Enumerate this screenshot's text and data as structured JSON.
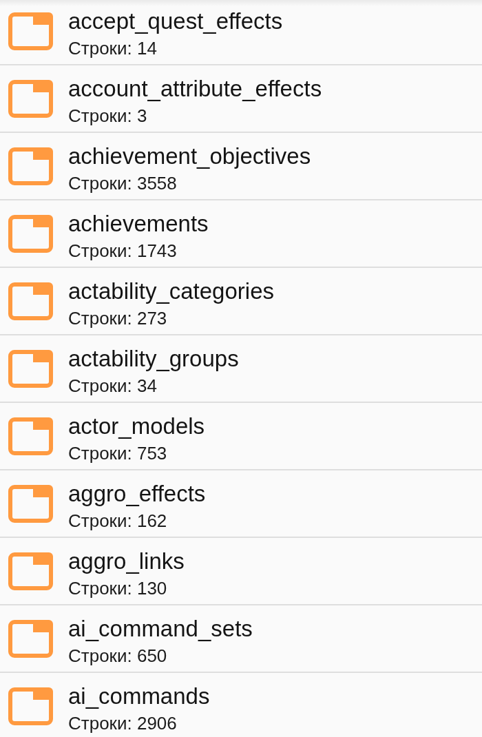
{
  "tables": [
    {
      "name": "accept_quest_effects",
      "subtitle": "Строки: 14"
    },
    {
      "name": "account_attribute_effects",
      "subtitle": "Строки: 3"
    },
    {
      "name": "achievement_objectives",
      "subtitle": "Строки: 3558"
    },
    {
      "name": "achievements",
      "subtitle": "Строки: 1743"
    },
    {
      "name": "actability_categories",
      "subtitle": "Строки: 273"
    },
    {
      "name": "actability_groups",
      "subtitle": "Строки: 34"
    },
    {
      "name": "actor_models",
      "subtitle": "Строки: 753"
    },
    {
      "name": "aggro_effects",
      "subtitle": "Строки: 162"
    },
    {
      "name": "aggro_links",
      "subtitle": "Строки: 130"
    },
    {
      "name": "ai_command_sets",
      "subtitle": "Строки: 650"
    },
    {
      "name": "ai_commands",
      "subtitle": "Строки: 2906"
    }
  ]
}
